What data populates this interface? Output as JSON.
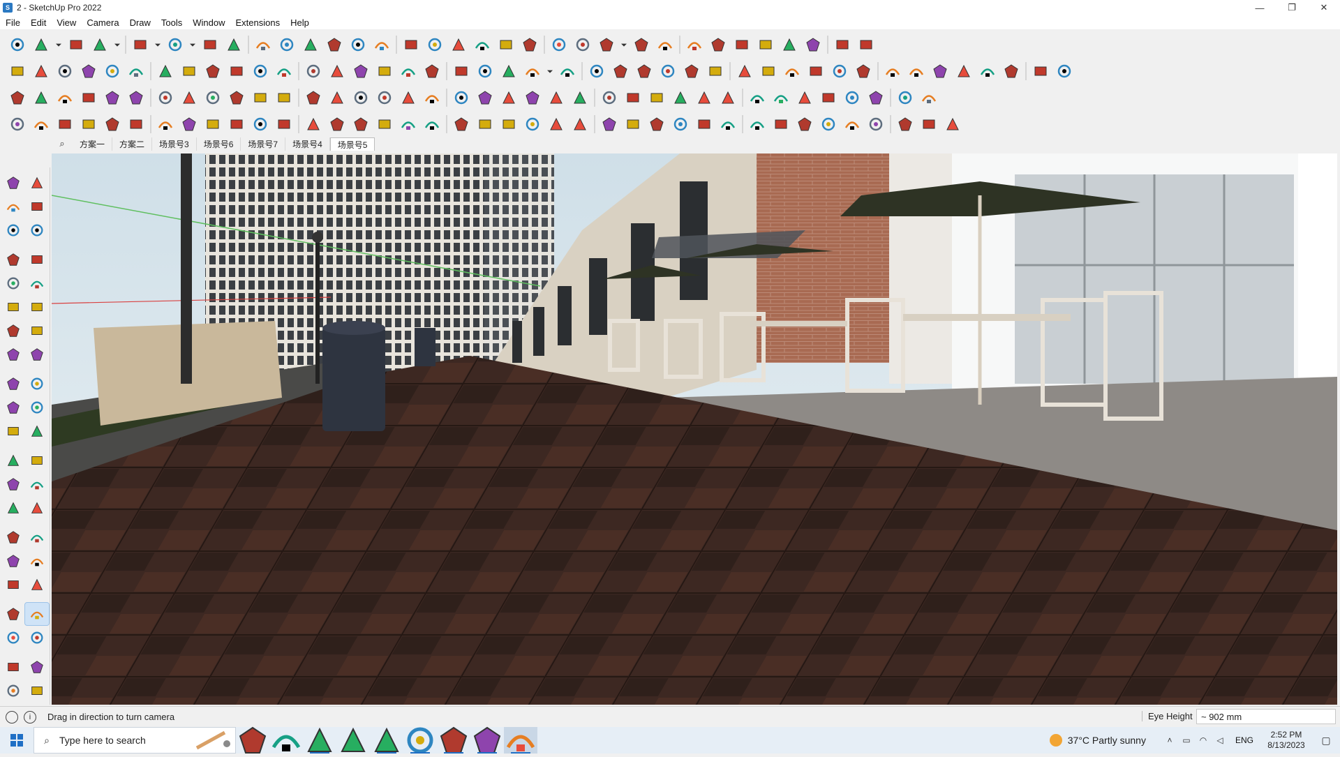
{
  "window": {
    "title": "2 - SketchUp Pro 2022",
    "app_icon_glyph": "S",
    "controls": [
      "minimize-icon",
      "maximize-icon",
      "close-icon"
    ],
    "control_glyphs": [
      "—",
      "❐",
      "✕"
    ]
  },
  "menu": [
    "File",
    "Edit",
    "View",
    "Camera",
    "Draw",
    "Tools",
    "Window",
    "Extensions",
    "Help"
  ],
  "toolbar_rows": [
    [
      "zoom-extents-icon",
      "select-icon",
      "select-dropdown-icon",
      "eraser-icon",
      "line-icon",
      "line-dropdown-icon",
      "arc-icon",
      "arc-dropdown-icon",
      "rectangle-icon",
      "rect-dropdown-icon",
      "push-pull-icon",
      "follow-me-icon",
      "move-icon",
      "rotate-icon",
      "scale-icon",
      "tape-measure-icon",
      "text-icon",
      "paint-bucket-icon",
      "orbit-icon",
      "pan-icon",
      "zoom-icon",
      "zoom-window-icon",
      "iso-view-icon",
      "top-view-icon",
      "front-view-icon",
      "right-view-icon",
      "account-icon",
      "account-dropdown-icon",
      "ext-warehouse-icon",
      "3d-warehouse-icon",
      "extension-manager-icon",
      "upload-icon",
      "download-icon",
      "send-layout-icon",
      "trimble-connect-icon",
      "undo-icon",
      "redo-icon",
      "model-info-icon"
    ],
    [
      "box-shaded-icon",
      "box-texture-icon",
      "box-xray-icon",
      "move-tool-icon",
      "blue-push-icon",
      "red-push-icon",
      "green-push-icon",
      "yellow-push-icon",
      "orange-push-icon",
      "magenta-push-icon",
      "curve-icon",
      "section-plane-icon",
      "section-cut-icon",
      "section-fill-icon",
      "leaf-icon",
      "plant-icon",
      "house-1-icon",
      "house-2-icon",
      "house-3-icon",
      "house-4-icon",
      "house-5-icon",
      "house-6-icon",
      "fx-dropdown-icon",
      "tag-icon",
      "pencil-icon",
      "rect-outline-icon",
      "circle-outline-icon",
      "hexagon-outline-icon",
      "ellipse-outline-icon",
      "parallelogram-icon",
      "arc-outline-icon",
      "bezier-icon",
      "freehand-icon",
      "lasso-icon",
      "spiral-icon",
      "red-pencil-icon",
      "eraser-pink-icon",
      "surface-1-icon",
      "surface-2-icon",
      "terrain-1-icon",
      "terrain-2-icon",
      "terrain-3-icon",
      "terrain-4-icon",
      "terrain-5-icon"
    ],
    [
      "blue-plane-icon",
      "blue-plane-2-icon",
      "yellow-plane-icon",
      "green-plane-icon",
      "red-plane-icon",
      "white-plane-icon",
      "orange-curve-icon",
      "red-square-icon",
      "grid-icon",
      "frame-icon",
      "wood-block-icon",
      "chain-icon",
      "arc-tool-icon",
      "bezier-red-icon",
      "red-cross-icon",
      "green-cross-icon",
      "blue-x-icon",
      "cone-icon",
      "drip-icon",
      "warning-icon",
      "hook-icon",
      "hook-2-icon",
      "spiral-black-icon",
      "snap-icon",
      "bucket-icon",
      "undo-red-icon",
      "green-tiles-icon",
      "red-cubes-icon",
      "cubes-2-icon",
      "red-box-icon",
      "pattern-icon",
      "panel-icon",
      "orange-grid-icon",
      "orange-grid-2-icon",
      "orange-grid-3-icon",
      "scatter-icon",
      "dotted-arc-icon",
      "qr-icon"
    ],
    [
      "node-icon",
      "path-icon",
      "red-car-icon",
      "knife-icon",
      "gear-icon",
      "chat-icon",
      "twist-icon",
      "shell-icon",
      "sphere-icon",
      "sphere-2-icon",
      "corner-icon",
      "corner-2-icon",
      "cut-line-icon",
      "dome-icon",
      "stair-icon",
      "sail-icon",
      "bars-icon",
      "cage-icon",
      "hand-icon",
      "leaf-outline-icon",
      "spline-icon",
      "stripe-icon",
      "fold-icon",
      "wire-icon",
      "wire-2-icon",
      "wire-3-icon",
      "panel-2-icon",
      "slope-icon",
      "bag-icon",
      "flag-icon",
      "screen-icon",
      "hatch-icon",
      "hatch-2-icon",
      "columns-icon",
      "mesh-icon",
      "mesh-2-icon",
      "comb-icon",
      "weave-icon",
      "shape-icon"
    ]
  ],
  "scenes": {
    "search_glyph": "⌕",
    "tabs": [
      "方案一",
      "方案二",
      "场景号3",
      "场景号6",
      "场景号7",
      "场景号4",
      "场景号5"
    ],
    "active_index": 6
  },
  "left_tools": [
    [
      "select-arrow-icon",
      "component-icon"
    ],
    [
      "paint-bucket-icon",
      "eraser-icon"
    ],
    [
      "tag-tool-icon",
      "pencil-icon"
    ],
    "gap",
    [
      "line-tool-icon",
      "freehand-tool-icon"
    ],
    [
      "rectangle-tool-icon",
      "rotated-rect-icon"
    ],
    [
      "circle-tool-icon",
      "polygon-tool-icon"
    ],
    [
      "arc-tool-icon",
      "arc-2pt-icon"
    ],
    [
      "arc-3pt-icon",
      "pie-icon"
    ],
    "gap",
    [
      "move-tool-icon",
      "push-pull-tool-icon"
    ],
    [
      "rotate-tool-icon",
      "follow-me-tool-icon"
    ],
    [
      "scale-tool-icon",
      "offset-tool-icon"
    ],
    "gap",
    [
      "tape-measure-tool-icon",
      "dimension-tool-icon"
    ],
    [
      "protractor-icon",
      "text-tool-icon"
    ],
    [
      "axes-tool-icon",
      "3d-text-icon"
    ],
    "gap",
    [
      "orbit-tool-icon",
      "pan-tool-icon"
    ],
    [
      "zoom-tool-icon",
      "zoom-window-tool-icon"
    ],
    [
      "zoom-extents-tool-icon",
      "previous-view-icon"
    ],
    "gap",
    [
      "position-camera-icon",
      "look-around-icon"
    ],
    [
      "walk-icon",
      "section-plane-tool-icon"
    ],
    "gap",
    [
      "iso-tool-icon",
      "top-tool-icon"
    ],
    [
      "front-tool-icon",
      "right-tool-icon"
    ]
  ],
  "left_active": "look-around-icon",
  "status": {
    "info_glyph": "i",
    "hint": "Drag in direction to turn camera",
    "measure_label": "Eye Height",
    "measure_value": "~ 902 mm"
  },
  "taskbar": {
    "search_placeholder": "Type here to search",
    "apps": [
      "task-view-icon",
      "calculator-icon",
      "file-explorer-icon",
      "acrobat-icon",
      "sketchup-viewer-icon",
      "edge-icon",
      "sticky-notes-icon",
      "layout-icon",
      "sketchup-icon"
    ],
    "active_app": "sketchup-icon",
    "weather": "37°C  Partly sunny",
    "lang": "ENG",
    "time": "2:52 PM",
    "date": "8/13/2023"
  },
  "colors": {
    "sky": "#dfe8ec",
    "pavement": "#3a2720",
    "brick": "#a4624a",
    "umbrella": "#2e3324",
    "chair": "#e8e2d8",
    "accent": "#1f6fc5"
  }
}
